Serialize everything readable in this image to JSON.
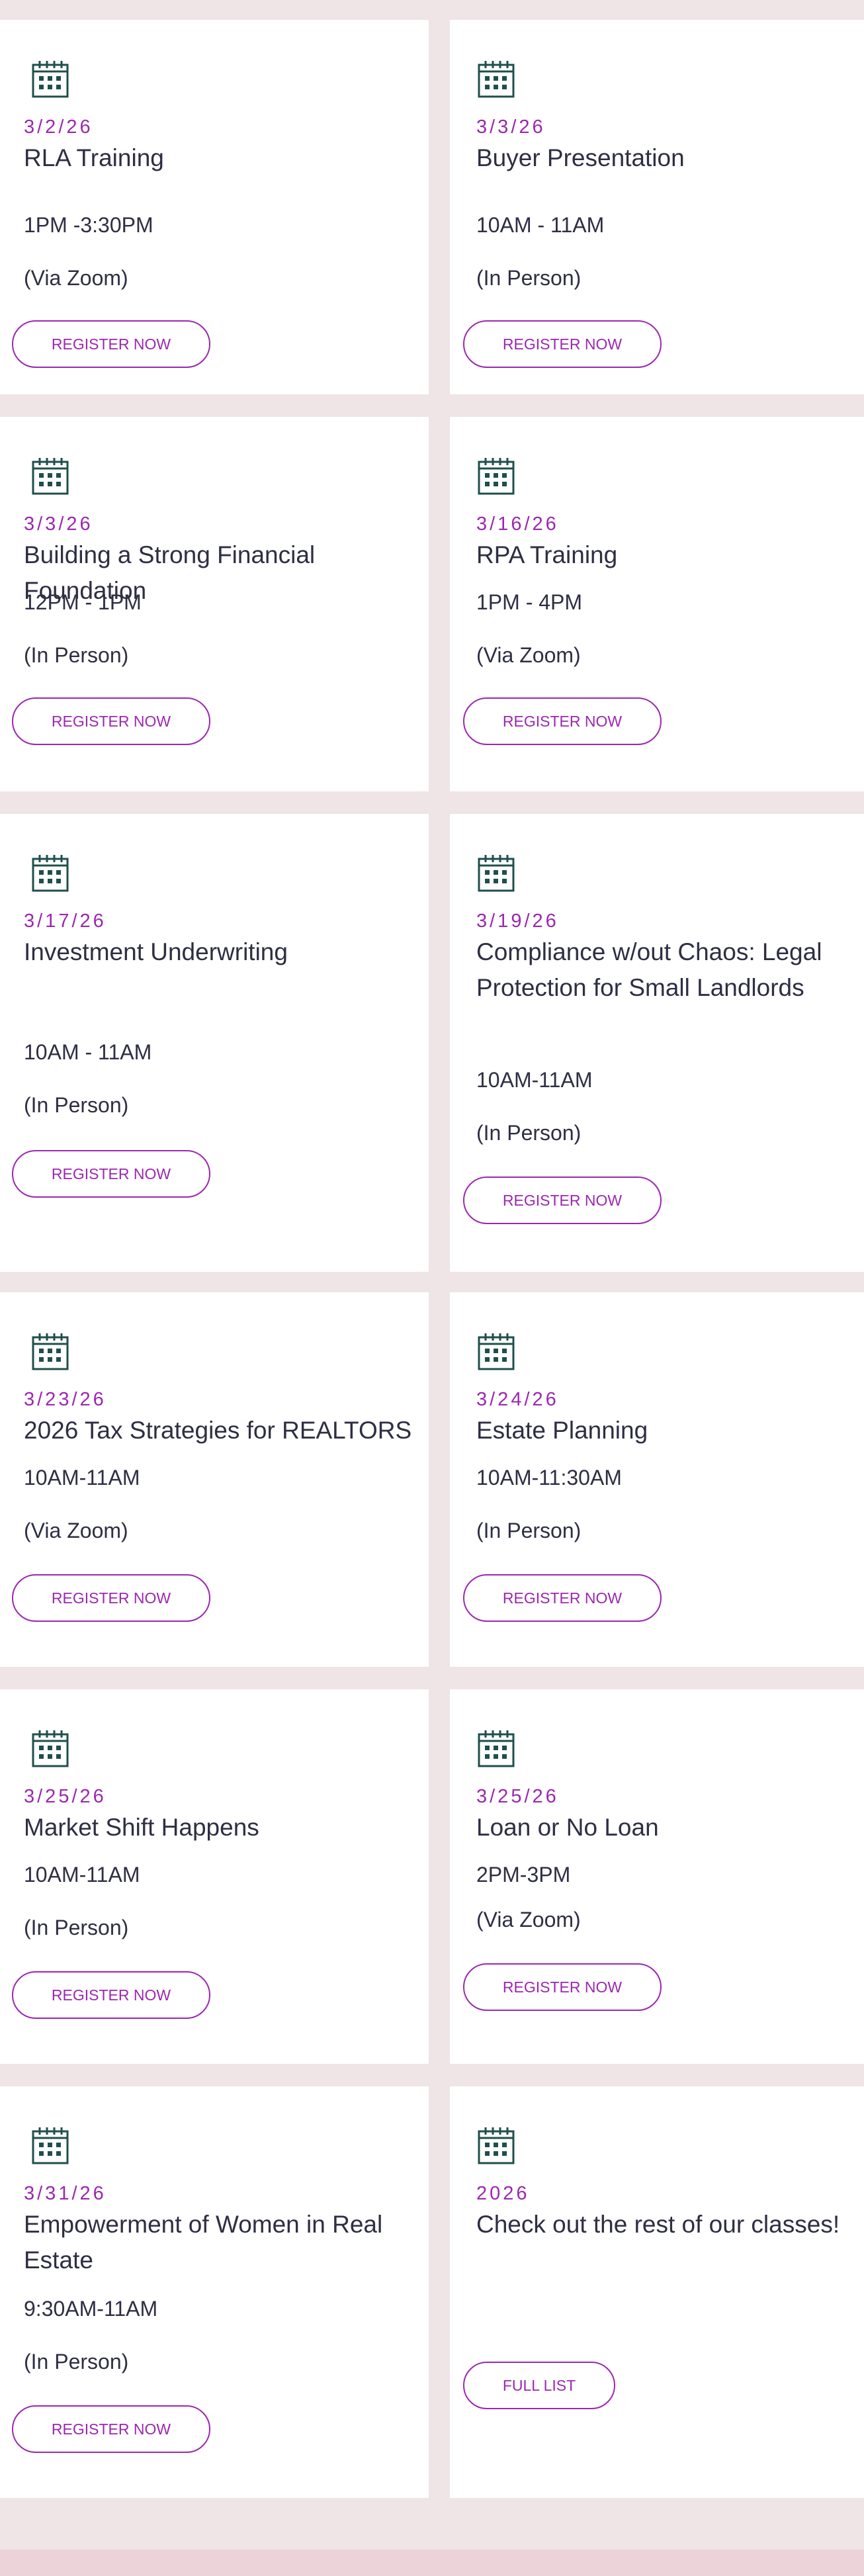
{
  "colors": {
    "accent": "#9c27b0",
    "icon": "#1f4f4c",
    "page_bg": "#efe4e6",
    "card_bg": "#ffffff"
  },
  "events": [
    {
      "date": "3/2/26",
      "title": "RLA Training",
      "time": "1PM -3:30PM",
      "mode": "(Via Zoom)",
      "button": "REGISTER NOW",
      "icon": "calendar-icon"
    },
    {
      "date": "3/3/26",
      "title": "Buyer Presentation",
      "time": "10AM - 11AM",
      "mode": "(In Person)",
      "button": "REGISTER NOW",
      "icon": "calendar-icon"
    },
    {
      "date": "3/3/26",
      "title": "Building a Strong Financial Foundation",
      "time": "12PM - 1PM",
      "mode": "(In Person)",
      "button": "REGISTER NOW",
      "icon": "calendar-icon"
    },
    {
      "date": "3/16/26",
      "title": "RPA Training",
      "time": "1PM - 4PM",
      "mode": "(Via Zoom)",
      "button": "REGISTER NOW",
      "icon": "calendar-icon"
    },
    {
      "date": "3/17/26",
      "title": "Investment Underwriting",
      "time": "10AM - 11AM",
      "mode": "(In Person)",
      "button": "REGISTER NOW",
      "icon": "calendar-icon"
    },
    {
      "date": "3/19/26",
      "title": "Compliance w/out Chaos: Legal Protection for Small Landlords",
      "time": "10AM-11AM",
      "mode": "(In Person)",
      "button": "REGISTER NOW",
      "icon": "calendar-icon"
    },
    {
      "date": "3/23/26",
      "title": "2026 Tax Strategies for REALTORS",
      "time": "10AM-11AM",
      "mode": "(Via Zoom)",
      "button": "REGISTER NOW",
      "icon": "calendar-icon"
    },
    {
      "date": "3/24/26",
      "title": "Estate Planning",
      "time": "10AM-11:30AM",
      "mode": "(In Person)",
      "button": "REGISTER NOW",
      "icon": "calendar-icon"
    },
    {
      "date": "3/25/26",
      "title": "Market Shift Happens",
      "time": "10AM-11AM",
      "mode": "(In Person)",
      "button": "REGISTER NOW",
      "icon": "calendar-icon"
    },
    {
      "date": "3/25/26",
      "title": "Loan or No Loan",
      "time": "2PM-3PM",
      "mode": "(Via Zoom)",
      "button": "REGISTER NOW",
      "icon": "calendar-icon"
    },
    {
      "date": "3/31/26",
      "title": "Empowerment of Women in Real Estate",
      "time": "9:30AM-11AM",
      "mode": "(In Person)",
      "button": "REGISTER NOW",
      "icon": "calendar-icon"
    },
    {
      "date": "2026",
      "title": "Check out the rest of our classes!",
      "button": "FULL LIST",
      "icon": "calendar-icon"
    }
  ]
}
